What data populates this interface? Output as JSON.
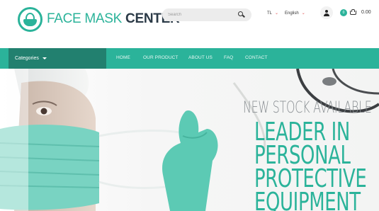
{
  "header": {
    "logo": {
      "text_light": "FACE MASK",
      "text_bold": "CENTER",
      "icon": "face-mask-logo-icon"
    },
    "search": {
      "placeholder": "Search",
      "icon": "search-icon"
    },
    "currency": {
      "label": "TL"
    },
    "language": {
      "label": "English"
    },
    "account_icon": "user-icon",
    "cart": {
      "count": "0",
      "total": "0.00",
      "icon": "basket-icon"
    }
  },
  "nav": {
    "categories_label": "Categories",
    "items": [
      {
        "label": "HOME"
      },
      {
        "label": "OUR PRODUCT"
      },
      {
        "label": "ABOUT US"
      },
      {
        "label": "FAQ"
      },
      {
        "label": "CONTACT"
      }
    ]
  },
  "hero": {
    "subtitle": "NEW STOCK AVAILABLE",
    "title": "LEADER IN\nPERSONAL\nPROTECTIVE\nEQUIPMENT"
  },
  "colors": {
    "brand_teal": "#2bb39a",
    "brand_dark_teal": "#22806f",
    "logo_dark": "#2b3a47",
    "accent_red": "#e14b4b"
  }
}
